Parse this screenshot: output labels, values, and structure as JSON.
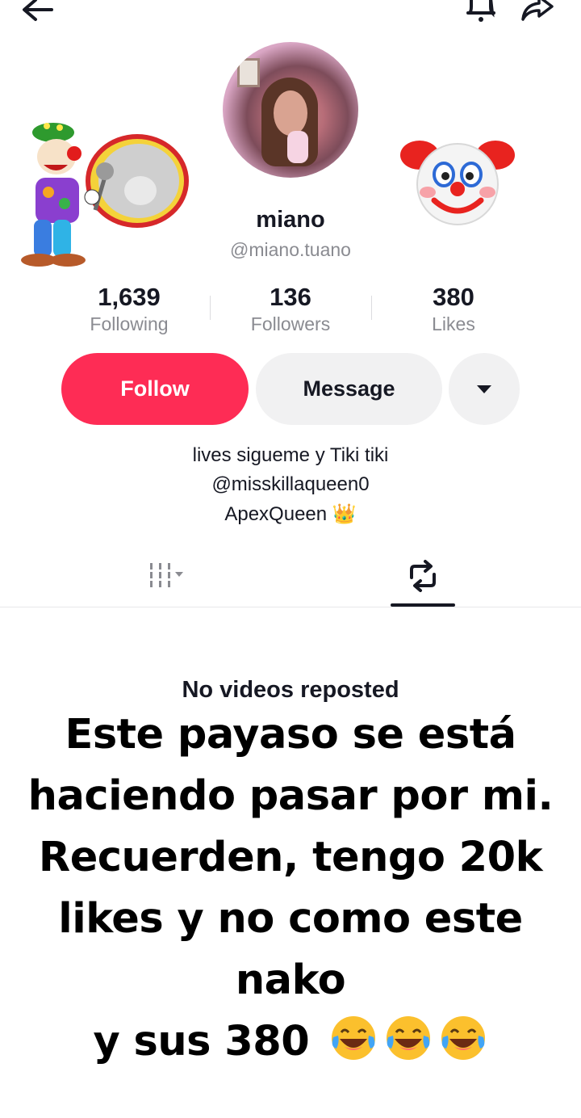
{
  "profile": {
    "name": "miano",
    "handle": "@miano.tuano"
  },
  "stats": {
    "following": {
      "value": "1,639",
      "label": "Following"
    },
    "followers": {
      "value": "136",
      "label": "Followers"
    },
    "likes": {
      "value": "380",
      "label": "Likes"
    }
  },
  "actions": {
    "follow": "Follow",
    "message": "Message"
  },
  "bio": {
    "line1": "lives   sigueme y Tiki tiki",
    "line2": "@misskillaqueen0",
    "line3": "ApexQueen 👑"
  },
  "tabs": {
    "active": "reposts"
  },
  "content": {
    "empty_message": "No videos reposted"
  },
  "caption": {
    "line1": "Este payaso se está",
    "line2": "haciendo pasar por mi.",
    "line3": "Recuerden, tengo 20k",
    "line4": "likes y no como este nako",
    "line5": "y sus 380"
  },
  "colors": {
    "accent": "#fe2c55",
    "text": "#161823",
    "secondary_text": "#8a8b91",
    "button_bg": "#f1f1f2"
  }
}
